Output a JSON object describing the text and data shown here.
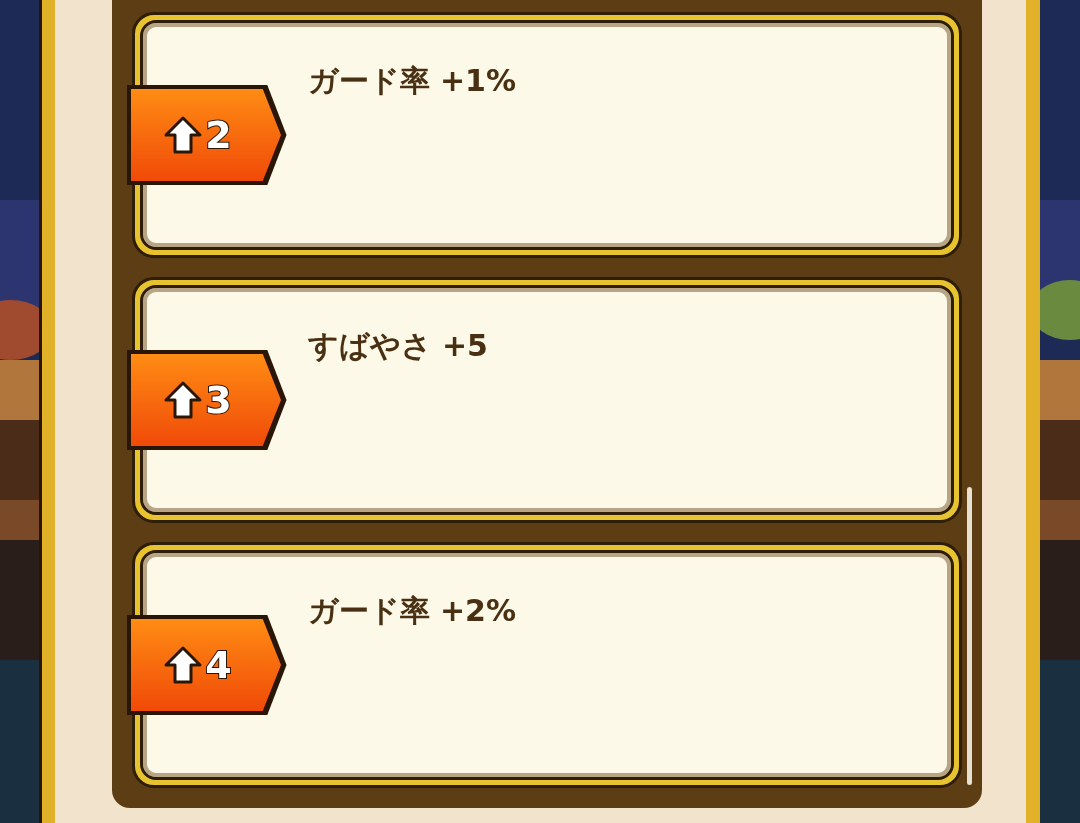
{
  "bonus_list": [
    {
      "step": "2",
      "effect": "ガード率 +1%"
    },
    {
      "step": "3",
      "effect": "すばやさ +5"
    },
    {
      "step": "4",
      "effect": "ガード率 +2%"
    }
  ]
}
